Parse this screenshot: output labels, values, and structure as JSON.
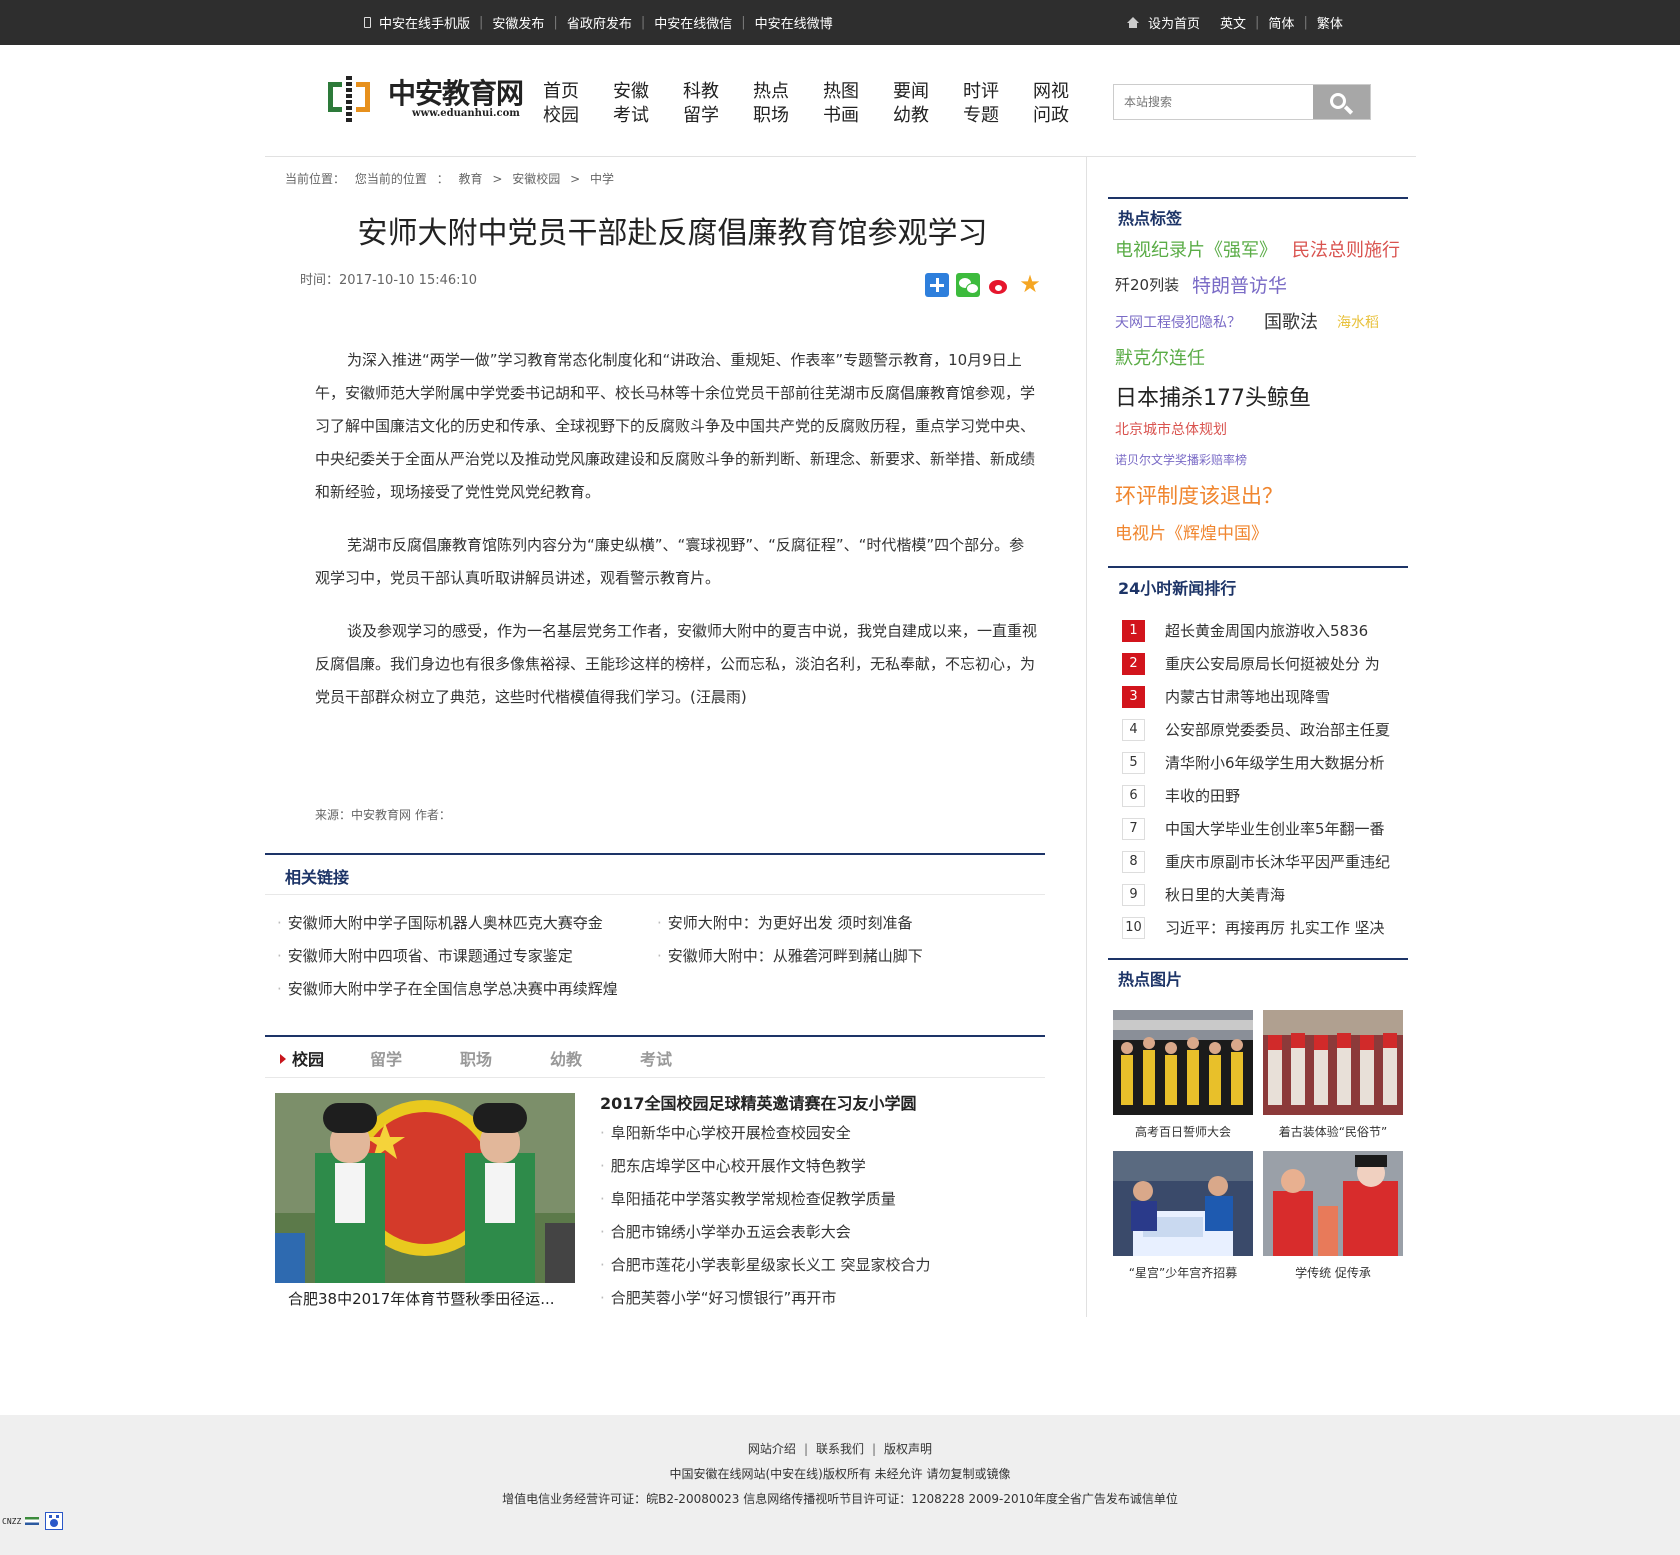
{
  "topbar": {
    "left": [
      "中安在线手机版",
      "安徽发布",
      "省政府发布",
      "中安在线微信",
      "中安在线微博"
    ],
    "sethome": "设为首页",
    "langs": [
      "英文",
      "简体",
      "繁体"
    ]
  },
  "logo": {
    "name": "中安教育网",
    "url": "www.eduanhui.com"
  },
  "nav": [
    [
      "首页",
      "校园"
    ],
    [
      "安徽",
      "考试"
    ],
    [
      "科教",
      "留学"
    ],
    [
      "热点",
      "职场"
    ],
    [
      "热图",
      "书画"
    ],
    [
      "要闻",
      "幼教"
    ],
    [
      "时评",
      "专题"
    ],
    [
      "网视",
      "问政"
    ]
  ],
  "search": {
    "placeholder": "本站搜索"
  },
  "breadcrumb": [
    "当前位置：",
    "您当前的位置",
    "：",
    "教育",
    ">",
    "安徽校园",
    ">",
    "中学"
  ],
  "article": {
    "title": "安师大附中党员干部赴反腐倡廉教育馆参观学习",
    "time": "时间：2017-10-10 15:46:10",
    "paragraphs": [
      "为深入推进“两学一做”学习教育常态化制度化和“讲政治、重规矩、作表率”专题警示教育，10月9日上午，安徽师范大学附属中学党委书记胡和平、校长马林等十余位党员干部前往芜湖市反腐倡廉教育馆参观，学习了解中国廉洁文化的历史和传承、全球视野下的反腐败斗争及中国共产党的反腐败历程，重点学习党中央、中央纪委关于全面从严治党以及推动党风廉政建设和反腐败斗争的新判断、新理念、新要求、新举措、新成绩和新经验，现场接受了党性党风党纪教育。",
      "芜湖市反腐倡廉教育馆陈列内容分为“廉史纵横”、“寰球视野”、“反腐征程”、“时代楷模”四个部分。参观学习中，党员干部认真听取讲解员讲述，观看警示教育片。",
      "谈及参观学习的感受，作为一名基层党务工作者，安徽师大附中的夏吉中说，我党自建成以来，一直重视反腐倡廉。我们身边也有很多像焦裕禄、王能珍这样的榜样，公而忘私，淡泊名利，无私奉献，不忘初心，为党员干部群众树立了典范，这些时代楷模值得我们学习。(汪晨雨)"
    ],
    "source": "来源：中安教育网  作者："
  },
  "related": {
    "title": "相关链接",
    "links": [
      "安徽师大附中学子国际机器人奥林匹克大赛夺金",
      "安师大附中：为更好出发 须时刻准备",
      "安徽师大附中四项省、市课题通过专家鉴定",
      "安徽师大附中：从雅砻河畔到赭山脚下",
      "安徽师大附中学子在全国信息学总决赛中再续辉煌"
    ]
  },
  "campus": {
    "tabs": [
      "校园",
      "留学",
      "职场",
      "幼教",
      "考试"
    ],
    "image_caption": "合肥38中2017年体育节暨秋季田径运...",
    "headline": "2017全国校园足球精英邀请赛在习友小学圆",
    "items": [
      "阜阳新华中心学校开展检查校园安全",
      "肥东店埠学区中心校开展作文特色教学",
      "阜阳插花中学落实教学常规检查促教学质量",
      "合肥市锦绣小学举办五运会表彰大会",
      "合肥市莲花小学表彰星级家长义工 突显家校合力",
      "合肥芙蓉小学“好习惯银行”再开市"
    ]
  },
  "hot_tags": {
    "title": "热点标签",
    "tags": [
      {
        "text": "电视纪录片《强军》",
        "color": "#5aac46"
      },
      {
        "text": "民法总则施行",
        "color": "#d9534f"
      },
      {
        "text": "歼20列装",
        "color": "#333333"
      },
      {
        "text": "特朗普访华",
        "color": "#7a6bc6"
      },
      {
        "text": "天网工程侵犯隐私？",
        "color": "#7a6bc6"
      },
      {
        "text": "国歌法",
        "color": "#333333"
      },
      {
        "text": "海水稻",
        "color": "#e8c13b"
      },
      {
        "text": "默克尔连任",
        "color": "#5aac46"
      },
      {
        "text": "日本捕杀177头鲸鱼",
        "color": "#222222"
      },
      {
        "text": "北京城市总体规划",
        "color": "#d9534f"
      },
      {
        "text": "诺贝尔文学奖播彩赔率榜",
        "color": "#7a6bc6"
      },
      {
        "text": "环评制度该退出？",
        "color": "#f0862f"
      },
      {
        "text": "电视片《辉煌中国》",
        "color": "#f0862f"
      }
    ]
  },
  "ranking": {
    "title": "24小时新闻排行",
    "items": [
      "超长黄金周国内旅游收入5836",
      "重庆公安局原局长何挺被处分 为",
      "内蒙古甘肃等地出现降雪",
      "公安部原党委委员、政治部主任夏",
      "清华附小6年级学生用大数据分析",
      "丰收的田野",
      "中国大学毕业生创业率5年翻一番",
      "重庆市原副市长沐华平因严重违纪",
      "秋日里的大美青海",
      "习近平：再接再厉 扎实工作 坚决"
    ],
    "numbers": [
      "1",
      "2",
      "3",
      "4",
      "5",
      "6",
      "7",
      "8",
      "9",
      "10"
    ]
  },
  "hot_pics": {
    "title": "热点图片",
    "captions": [
      "高考百日誓师大会",
      "着古装体验“民俗节”",
      "“星宫”少年宫齐招募",
      "学传统 促传承"
    ]
  },
  "footer": {
    "links": [
      "网站介绍",
      "联系我们",
      "版权声明"
    ],
    "line2": "中国安徽在线网站(中安在线)版权所有 未经允许 请勿复制或镜像",
    "line3": "增值电信业务经营许可证：皖B2-20080023 信息网络传播视听节目许可证：1208228  2009-2010年度全省广告发布诚信单位",
    "badge": "CNZZ"
  }
}
